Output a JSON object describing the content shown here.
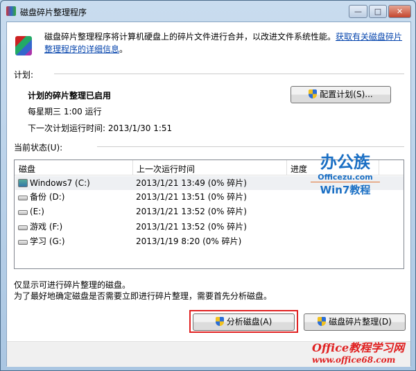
{
  "window": {
    "title": "磁盘碎片整理程序",
    "minimize": "—",
    "maximize": "□",
    "close": "✕"
  },
  "header": {
    "description": "磁盘碎片整理程序将计算机硬盘上的碎片文件进行合并，以改进文件系统性能。",
    "link": "获取有关磁盘碎片整理程序的详细信息",
    "link_suffix": "。"
  },
  "schedule": {
    "label": "计划:",
    "status": "计划的碎片整理已启用",
    "frequency": "每星期三  1:00 运行",
    "next_run": "下一次计划运行时间: 2013/1/30 1:51",
    "configure_button": "配置计划(S)..."
  },
  "current_status": {
    "label": "当前状态(U):",
    "columns": [
      "磁盘",
      "上一次运行时间",
      "进度"
    ],
    "rows": [
      {
        "disk": "Windows7 (C:)",
        "last_run": "2013/1/21 13:49 (0% 碎片)",
        "system": true
      },
      {
        "disk": "备份 (D:)",
        "last_run": "2013/1/21 13:51 (0% 碎片)"
      },
      {
        "disk": "(E:)",
        "last_run": "2013/1/21 13:52 (0% 碎片)"
      },
      {
        "disk": "游戏 (F:)",
        "last_run": "2013/1/21 13:52 (0% 碎片)"
      },
      {
        "disk": "学习 (G:)",
        "last_run": "2013/1/19 8:20 (0% 碎片)"
      }
    ]
  },
  "notes": [
    "仅显示可进行碎片整理的磁盘。",
    "为了最好地确定磁盘是否需要立即进行碎片整理，需要首先分析磁盘。"
  ],
  "buttons": {
    "analyze": "分析磁盘(A)",
    "defragment": "磁盘碎片整理(D)"
  },
  "watermarks": {
    "top_brand": "办公族",
    "top_url": "Officezu.com",
    "top_sub": "Win7教程",
    "bottom_brand": "Office教程学习网",
    "bottom_url": "www.office68.com"
  },
  "colors": {
    "highlight": "#e02020",
    "link": "#0645ad"
  }
}
